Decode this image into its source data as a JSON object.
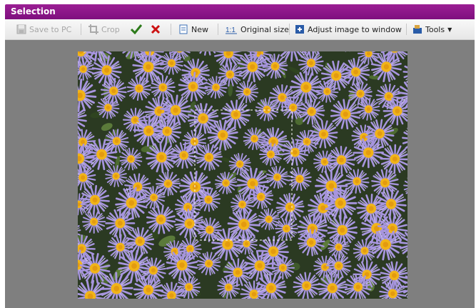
{
  "window": {
    "title": "Selection"
  },
  "toolbar": {
    "save_to_pc": "Save to PC",
    "crop": "Crop",
    "new": "New",
    "original_size": "Original size",
    "adjust_image": "Adjust image to window",
    "tools": "Tools"
  },
  "colors": {
    "titlebar": "#86128a",
    "accent_confirm": "#2c7a1a",
    "accent_cancel": "#cc1111",
    "workspace": "#7f7f7f",
    "flower": "#a795de",
    "flower_center": "#f0b418"
  }
}
